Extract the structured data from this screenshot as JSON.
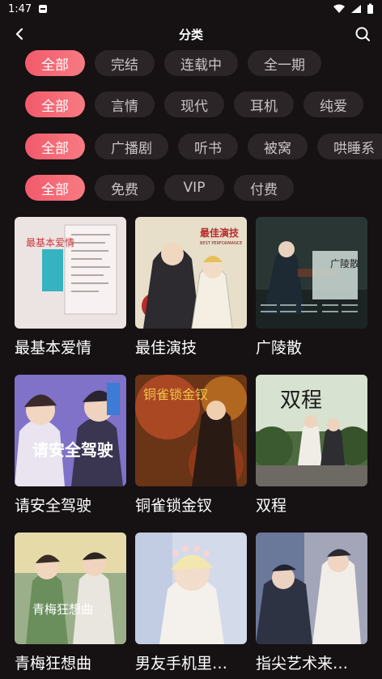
{
  "status": {
    "time": "1:47"
  },
  "header": {
    "title": "分类"
  },
  "filters": [
    {
      "chips": [
        "全部",
        "完结",
        "连载中",
        "全一期"
      ],
      "active": 0
    },
    {
      "chips": [
        "全部",
        "言情",
        "现代",
        "耳机",
        "纯爱"
      ],
      "active": 0
    },
    {
      "chips": [
        "全部",
        "广播剧",
        "听书",
        "被窝",
        "哄睡系"
      ],
      "active": 0
    },
    {
      "chips": [
        "全部",
        "免费",
        "VIP",
        "付费"
      ],
      "active": 0
    }
  ],
  "items": [
    {
      "title": "最基本爱情",
      "cover_text": "最基本爱情",
      "colors": [
        "#efe7e6",
        "#3aa9b8"
      ]
    },
    {
      "title": "最佳演技",
      "cover_text": "最佳演技",
      "cover_sub": "BEST PERFORMANCE",
      "colors": [
        "#e8e0cc",
        "#b92b2b"
      ]
    },
    {
      "title": "广陵散",
      "cover_text": "广陵散",
      "colors": [
        "#2d3b3a",
        "#b5c6bd"
      ]
    },
    {
      "title": "请安全驾驶",
      "cover_text": "请安全驾驶",
      "colors": [
        "#7a6cc4",
        "#f2a14a"
      ]
    },
    {
      "title": "铜雀锁金钗",
      "cover_text": "铜雀锁金钗",
      "colors": [
        "#5a2a12",
        "#e3a233"
      ]
    },
    {
      "title": "双程",
      "cover_text": "双程",
      "colors": [
        "#3e5634",
        "#c9d7c2"
      ]
    },
    {
      "title": "青梅狂想曲",
      "cover_text": "青梅狂想曲",
      "colors": [
        "#8ba57b",
        "#e9d9a4"
      ]
    },
    {
      "title": "男友手机里…",
      "cover_text": "",
      "colors": [
        "#c9d2e8",
        "#f3efe9"
      ]
    },
    {
      "title": "指尖艺术来…",
      "cover_text": "",
      "colors": [
        "#5c6a8c",
        "#e9d8cc"
      ]
    }
  ]
}
